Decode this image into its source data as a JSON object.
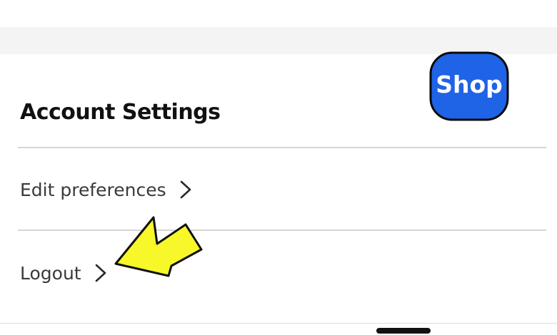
{
  "app": {
    "badge_label": "Shop",
    "badge_color": "#1f63e6",
    "badge_icon": "shop-app-icon"
  },
  "section": {
    "title": "Account Settings"
  },
  "menu": {
    "items": [
      {
        "label": "Edit preferences",
        "icon": "chevron-right-icon"
      },
      {
        "label": "Logout",
        "icon": "chevron-right-icon"
      }
    ]
  },
  "annotation": {
    "icon": "yellow-pointer-arrow-icon",
    "color": "#f7f72a"
  }
}
